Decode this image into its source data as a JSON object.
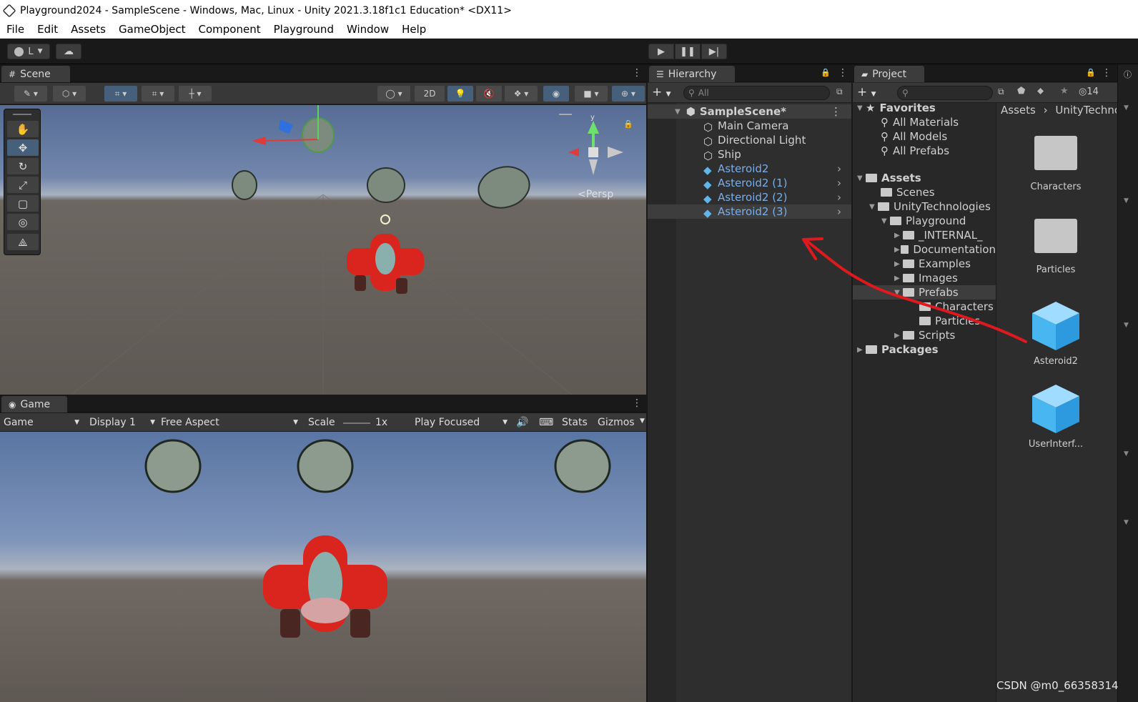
{
  "window": {
    "title": "Playground2024 - SampleScene - Windows, Mac, Linux - Unity 2021.3.18f1c1 Education* <DX11>"
  },
  "menu": [
    "File",
    "Edit",
    "Assets",
    "GameObject",
    "Component",
    "Playground",
    "Window",
    "Help"
  ],
  "toolbar": {
    "account_label": "L"
  },
  "scene": {
    "tab_label": "Scene",
    "mode_2d": "2D",
    "persp_label": "<Persp",
    "gizmo_y": "y"
  },
  "game": {
    "tab_label": "Game",
    "view": "Game",
    "display": "Display 1",
    "aspect": "Free Aspect",
    "scale_label": "Scale",
    "scale_value": "1x",
    "play_mode": "Play Focused",
    "stats": "Stats",
    "gizmos": "Gizmos"
  },
  "hierarchy": {
    "tab_label": "Hierarchy",
    "search_placeholder": "All",
    "scene_name": "SampleScene*",
    "items": [
      {
        "label": "Main Camera",
        "prefab": false
      },
      {
        "label": "Directional Light",
        "prefab": false
      },
      {
        "label": "Ship",
        "prefab": false
      },
      {
        "label": "Asteroid2",
        "prefab": true
      },
      {
        "label": "Asteroid2 (1)",
        "prefab": true
      },
      {
        "label": "Asteroid2 (2)",
        "prefab": true
      },
      {
        "label": "Asteroid2 (3)",
        "prefab": true
      }
    ]
  },
  "project": {
    "tab_label": "Project",
    "hidden_count": "14",
    "breadcrumb": [
      "Assets",
      "UnityTechno"
    ],
    "favorites_label": "Favorites",
    "favorites": [
      "All Materials",
      "All Models",
      "All Prefabs"
    ],
    "assets_label": "Assets",
    "tree": {
      "scenes": "Scenes",
      "unity_tech": "UnityTechnologies",
      "playground": "Playground",
      "internal": "_INTERNAL_",
      "documentation": "Documentation",
      "examples": "Examples",
      "images": "Images",
      "prefabs": "Prefabs",
      "characters": "Characters",
      "particles": "Particles",
      "scripts": "Scripts"
    },
    "packages_label": "Packages",
    "grid": [
      "Characters",
      "Particles",
      "Asteroid2",
      "UserInterf..."
    ]
  },
  "watermark": "CSDN @m0_66358314",
  "colors": {
    "prefab_blue": "#7aaee8",
    "annotation_red": "#e0191f",
    "selection_blue": "#46607c"
  }
}
